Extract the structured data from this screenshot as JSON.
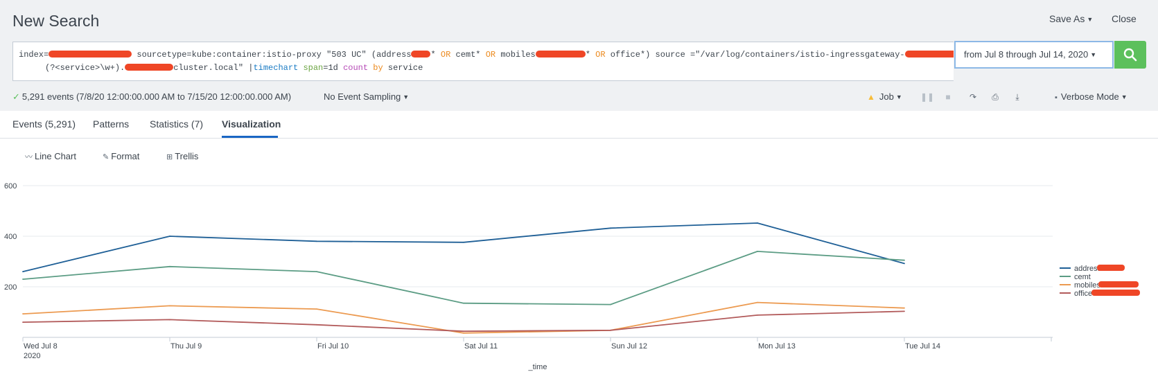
{
  "header": {
    "title": "New Search",
    "save_as": "Save As",
    "close": "Close"
  },
  "search": {
    "line1_a": "index=",
    "line1_b": " sourcetype=kube:container:istio-proxy \"503 UC\" (address",
    "line1_c": "* ",
    "or1": "OR",
    "line1_d": " cemt* ",
    "or2": "OR",
    "line1_e": " mobiles",
    "line1_f": "* ",
    "or3": "OR",
    "line1_g": " office*) source =\"/var/log/containers/istio-ingressgateway-",
    "line2_a": "(?<service>\\w+).",
    "line2_b": "cluster.local\" |",
    "cmd": "timechart",
    "arg": "span",
    "arg_val": "=1d ",
    "fn": "count",
    "by": "by",
    "field": " service"
  },
  "time_range": "from Jul 8 through Jul 14, 2020",
  "status": {
    "events_summary": "5,291 events (7/8/20 12:00:00.000 AM to 7/15/20 12:00:00.000 AM)",
    "sampling": "No Event Sampling",
    "job": "Job",
    "mode": "Verbose Mode"
  },
  "tabs": [
    {
      "label": "Events (5,291)"
    },
    {
      "label": "Patterns"
    },
    {
      "label": "Statistics (7)"
    },
    {
      "label": "Visualization"
    }
  ],
  "viz_toolbar": {
    "chart_type": "Line Chart",
    "format": "Format",
    "trellis": "Trellis"
  },
  "icons": {
    "check": "check-icon",
    "warning": "warning-icon",
    "search": "search-icon",
    "pause": "pause-icon",
    "stop": "stop-icon",
    "share": "share-icon",
    "print": "print-icon",
    "export": "export-icon",
    "mode": "mode-icon"
  },
  "colors": {
    "accent": "#1a66c4",
    "search_button": "#5cc05c",
    "redaction": "#ef4626"
  },
  "chart_data": {
    "type": "line",
    "categories": [
      "Wed Jul 8\n2020",
      "Thu Jul 9",
      "Fri Jul 10",
      "Sat Jul 11",
      "Sun Jul 12",
      "Mon Jul 13",
      "Tue Jul 14"
    ],
    "xlabel": "_time",
    "ylabel": "",
    "yticks": [
      200,
      400,
      600
    ],
    "ylim": [
      0,
      600
    ],
    "grid": true,
    "legend_position": "right",
    "series": [
      {
        "name": "address",
        "color": "#1e5f96",
        "values": [
          260,
          400,
          380,
          376,
          432,
          452,
          292
        ]
      },
      {
        "name": "cemt",
        "color": "#5b9c84",
        "values": [
          230,
          280,
          260,
          135,
          130,
          340,
          305
        ]
      },
      {
        "name": "mobiles",
        "color": "#ec9a50",
        "values": [
          93,
          125,
          112,
          17,
          28,
          138,
          116
        ]
      },
      {
        "name": "office",
        "color": "#b25a5a",
        "values": [
          60,
          70,
          50,
          24,
          28,
          88,
          103
        ]
      }
    ]
  }
}
